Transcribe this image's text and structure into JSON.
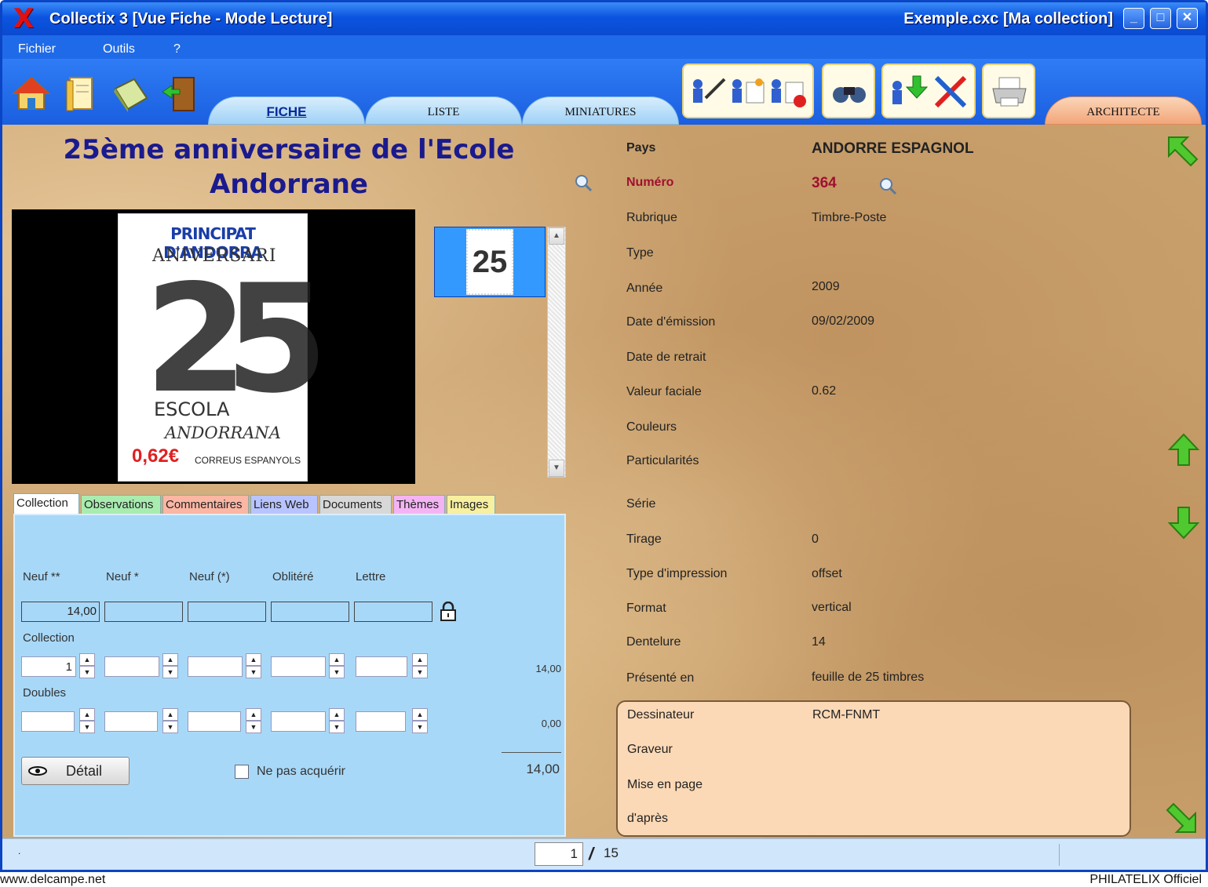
{
  "window": {
    "title": "Collectix 3 [Vue Fiche - Mode Lecture]",
    "file_title": "Exemple.cxc [Ma collection]",
    "logo": "X",
    "minimize": "_",
    "maximize": "□",
    "close": "✕"
  },
  "menu": [
    "Fichier",
    "Outils",
    "?"
  ],
  "view_tabs": {
    "fiche": "FICHE",
    "liste": "LISTE",
    "miniatures": "MINIATURES",
    "architecte": "ARCHITECTE"
  },
  "stamp": {
    "title": "25ème anniversaire de l'Ecole Andorrane",
    "image_text": {
      "top": "PRINCIPAT D'ANDORRA",
      "aniversari": "ANIVERSARI",
      "number": "25",
      "escola": "ESCOLA",
      "andorrana": "ANDORRANA",
      "value": "0,62€",
      "correus": "CORREUS ESPANYOLS"
    }
  },
  "detail_tabs": [
    "Collection",
    "Observations",
    "Commentaires",
    "Liens Web",
    "Documents",
    "Thèmes",
    "Images"
  ],
  "collection": {
    "headers": [
      "Neuf **",
      "Neuf *",
      "Neuf (*)",
      "Oblitéré",
      "Lettre"
    ],
    "prices": [
      "14,00",
      "",
      "",
      "",
      ""
    ],
    "collection_label": "Collection",
    "collection_qty": [
      "1",
      "",
      "",
      "",
      ""
    ],
    "collection_total": "14,00",
    "doubles_label": "Doubles",
    "doubles_qty": [
      "",
      "",
      "",
      "",
      ""
    ],
    "doubles_total": "0,00",
    "grand_total": "14,00",
    "detail_button": "Détail",
    "no_buy_label": "Ne pas acquérir"
  },
  "fields": {
    "pays": {
      "label": "Pays",
      "value": "ANDORRE ESPAGNOL"
    },
    "numero": {
      "label": "Numéro",
      "value": "364"
    },
    "rubrique": {
      "label": "Rubrique",
      "value": "Timbre-Poste"
    },
    "type": {
      "label": "Type",
      "value": ""
    },
    "annee": {
      "label": "Année",
      "value": "2009"
    },
    "date_emission": {
      "label": "Date d'émission",
      "value": "09/02/2009"
    },
    "date_retrait": {
      "label": "Date de retrait",
      "value": ""
    },
    "valeur_faciale": {
      "label": "Valeur faciale",
      "value": "0.62"
    },
    "couleurs": {
      "label": "Couleurs",
      "value": ""
    },
    "particularites": {
      "label": "Particularités",
      "value": ""
    },
    "serie": {
      "label": "Série",
      "value": ""
    },
    "tirage": {
      "label": "Tirage",
      "value": "0"
    },
    "type_impression": {
      "label": "Type d'impression",
      "value": "offset"
    },
    "format": {
      "label": "Format",
      "value": "vertical"
    },
    "dentelure": {
      "label": "Dentelure",
      "value": "14"
    },
    "presente_en": {
      "label": "Présenté en",
      "value": "feuille de 25 timbres"
    }
  },
  "people": {
    "dessinateur": {
      "label": "Dessinateur",
      "value": "RCM-FNMT"
    },
    "graveur": {
      "label": "Graveur",
      "value": ""
    },
    "mise_en_page": {
      "label": "Mise en page",
      "value": ""
    },
    "dapres": {
      "label": "d'après",
      "value": ""
    }
  },
  "status": {
    "left": ".",
    "page": "1",
    "separator": "/",
    "total": "15"
  },
  "footer": {
    "left": "www.delcampe.net",
    "right": "PHILATELIX Officiel"
  },
  "colors": {
    "title_blue": "#1a1a8e",
    "numero_red": "#a01030",
    "panel_blue": "#a8d8f8",
    "people_bg": "#fcd9b6"
  }
}
